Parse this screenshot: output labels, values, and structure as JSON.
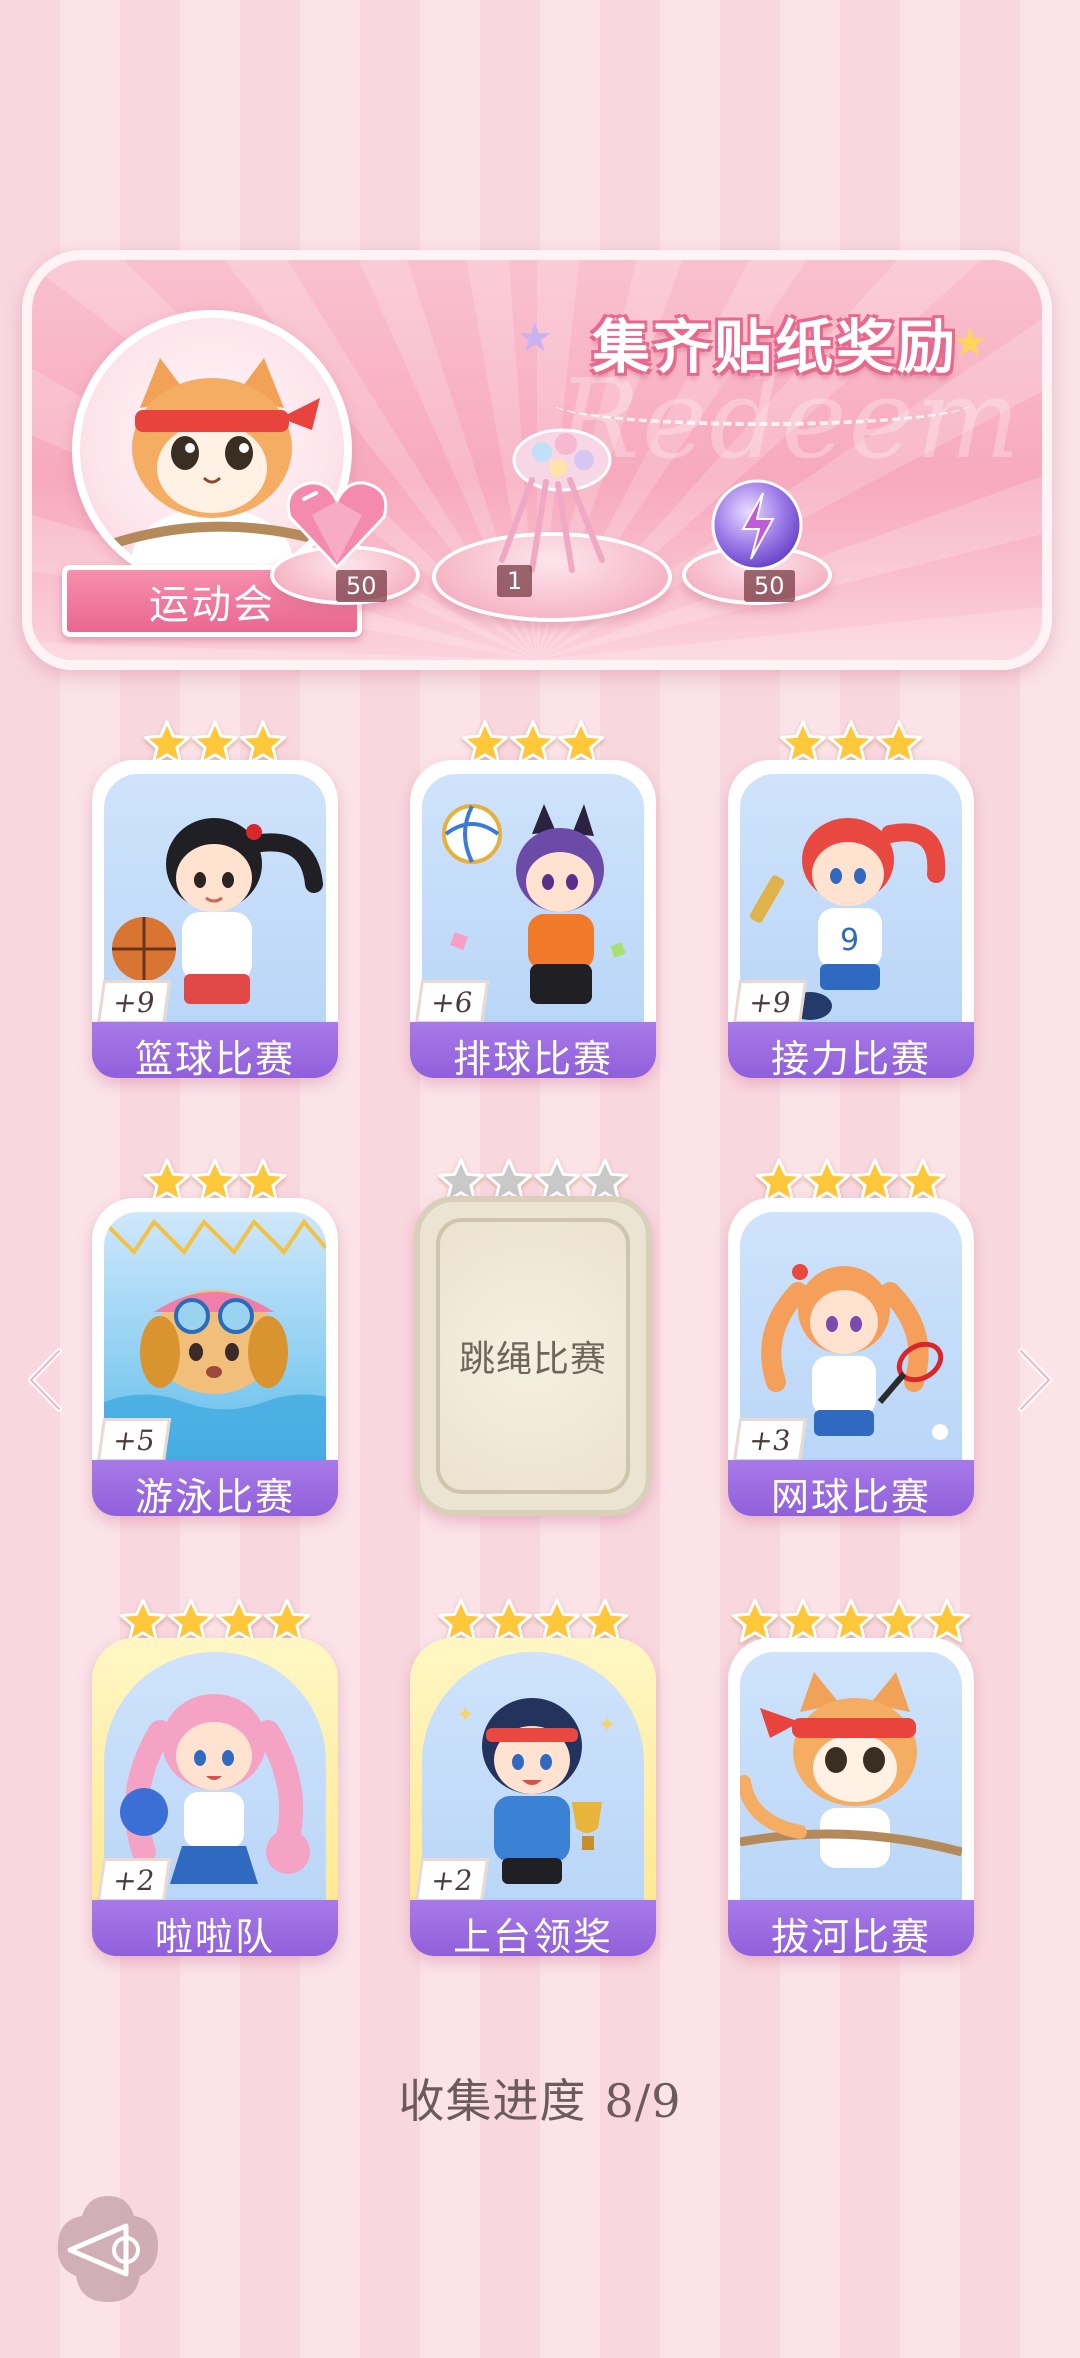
{
  "banner": {
    "title": "集齐贴纸奖励",
    "watermark": "Redeem",
    "avatar_label": "运动会",
    "rewards": [
      {
        "icon": "heart-gem-icon",
        "count": "50"
      },
      {
        "icon": "bouquet-icon",
        "count": "1"
      },
      {
        "icon": "energy-orb-icon",
        "count": "50"
      }
    ]
  },
  "cards": [
    {
      "label": "篮球比赛",
      "badge": "+9",
      "stars": 3,
      "collected": true
    },
    {
      "label": "排球比赛",
      "badge": "+6",
      "stars": 3,
      "collected": true
    },
    {
      "label": "接力比赛",
      "badge": "+9",
      "stars": 3,
      "collected": true
    },
    {
      "label": "游泳比赛",
      "badge": "+5",
      "stars": 3,
      "collected": true
    },
    {
      "label": "跳绳比赛",
      "badge": "",
      "stars": 4,
      "collected": false
    },
    {
      "label": "网球比赛",
      "badge": "+3",
      "stars": 4,
      "collected": true
    },
    {
      "label": "啦啦队",
      "badge": "+2",
      "stars": 4,
      "collected": true
    },
    {
      "label": "上台领奖",
      "badge": "+2",
      "stars": 4,
      "collected": true
    },
    {
      "label": "拔河比赛",
      "badge": "",
      "stars": 5,
      "collected": true
    }
  ],
  "progress": {
    "label": "收集进度",
    "value": "8/9"
  },
  "colors": {
    "accent_purple": "#9a6ae0",
    "banner_pink": "#f7a9bd",
    "star_gold": "#ffc83a",
    "star_gray": "#c9c9c9"
  }
}
